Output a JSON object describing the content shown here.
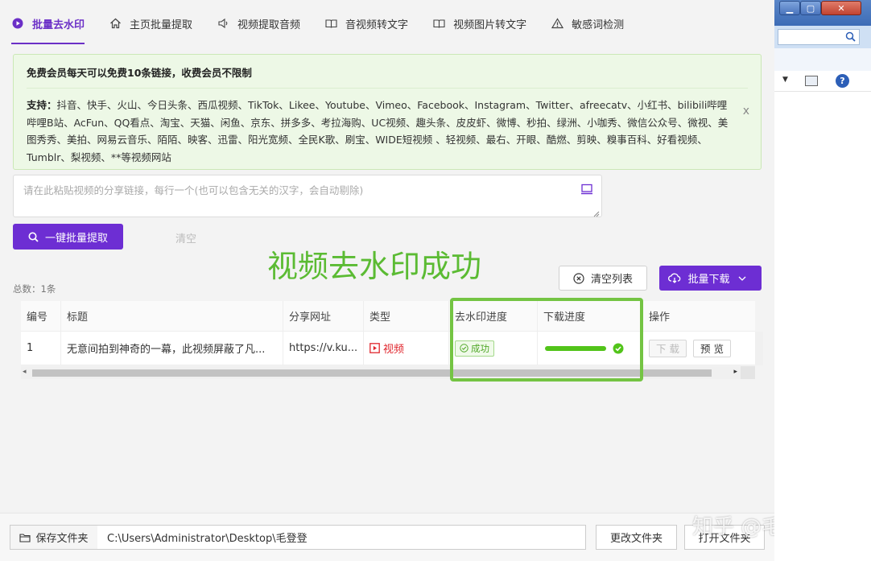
{
  "tabs": [
    {
      "label": "批量去水印",
      "icon": "play-circle-icon",
      "active": true
    },
    {
      "label": "主页批量提取",
      "icon": "home-icon",
      "active": false
    },
    {
      "label": "视频提取音频",
      "icon": "speaker-icon",
      "active": false
    },
    {
      "label": "音视频转文字",
      "icon": "book-icon",
      "active": false
    },
    {
      "label": "视频图片转文字",
      "icon": "book-icon",
      "active": false
    },
    {
      "label": "敏感词检测",
      "icon": "warning-icon",
      "active": false
    }
  ],
  "notice": {
    "title": "免费会员每天可以免费10条链接，收费会员不限制",
    "support_label": "支持：",
    "support_text": "抖音、快手、火山、今日头条、西瓜视频、TikTok、Likee、Youtube、Vimeo、Facebook、Instagram、Twitter、afreecatv、小红书、bilibili哔哩哔哩B站、AcFun、QQ看点、淘宝、天猫、闲鱼、京东、拼多多、考拉海购、UC视频、趣头条、皮皮虾、微博、秒拍、绿洲、小咖秀、微信公众号、微视、美图秀秀、美拍、网易云音乐、陌陌、映客、迅雷、阳光宽频、全民K歌、刷宝、WIDE短视频 、轻视频、最右、开眼、酷燃、剪映、糗事百科、好看视频、Tumblr、梨视频、**等视频网站",
    "close": "x"
  },
  "paste": {
    "placeholder": "请在此粘贴视频的分享链接，每行一个(也可以包含无关的汉字，会自动剔除)"
  },
  "actions": {
    "extract": "一键批量提取",
    "clear": "清空",
    "clear_list": "清空列表",
    "batch_download": "批量下载"
  },
  "overlay_caption": "视频去水印成功",
  "total": "总数：1条",
  "table": {
    "headers": [
      "编号",
      "标题",
      "分享网址",
      "类型",
      "去水印进度",
      "下载进度",
      "操作"
    ],
    "rows": [
      {
        "no": "1",
        "title": "无意间拍到神奇的一幕，此视频屏蔽了凡...",
        "url": "https://v.ku...",
        "type": "视频",
        "watermark_status": "成功",
        "download_progress": 1.0,
        "op_download": "下 载",
        "op_preview": "预 览"
      }
    ]
  },
  "footer": {
    "save_label": "保存文件夹",
    "path": "C:\\Users\\Administrator\\Desktop\\毛登登",
    "change_folder": "更改文件夹",
    "open_folder": "打开文件夹"
  },
  "watermark": "知乎 @毛登登",
  "colors": {
    "accent": "#6d2ed3",
    "success": "#52c41a",
    "highlight": "#74c443",
    "notice_bg": "#edf8e6",
    "type_red": "#e0262d"
  }
}
